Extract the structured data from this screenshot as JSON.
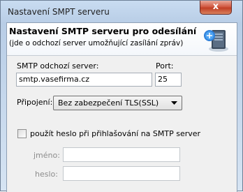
{
  "window": {
    "title": "Nastavení SMPT serveru",
    "close_label": "x"
  },
  "banner": {
    "title": "Nastavení SMTP serveru pro odesílání",
    "subtitle": "(jde o odchozí server umožňující zasílání zpráv)",
    "icon": "server-icon"
  },
  "smtp": {
    "server_label": "SMTP odchozí server:",
    "server_value": "smtp.vasefirma.cz",
    "port_label": "Port:",
    "port_value": "25"
  },
  "connection": {
    "label": "Připojení:",
    "selected": "Bez zabezpečení TLS(SSL)"
  },
  "auth": {
    "checkbox_label": "použít heslo při přihlašování na SMTP server",
    "checked": false,
    "name_label": "jméno:",
    "name_value": "",
    "password_label": "heslo:",
    "password_value": ""
  }
}
